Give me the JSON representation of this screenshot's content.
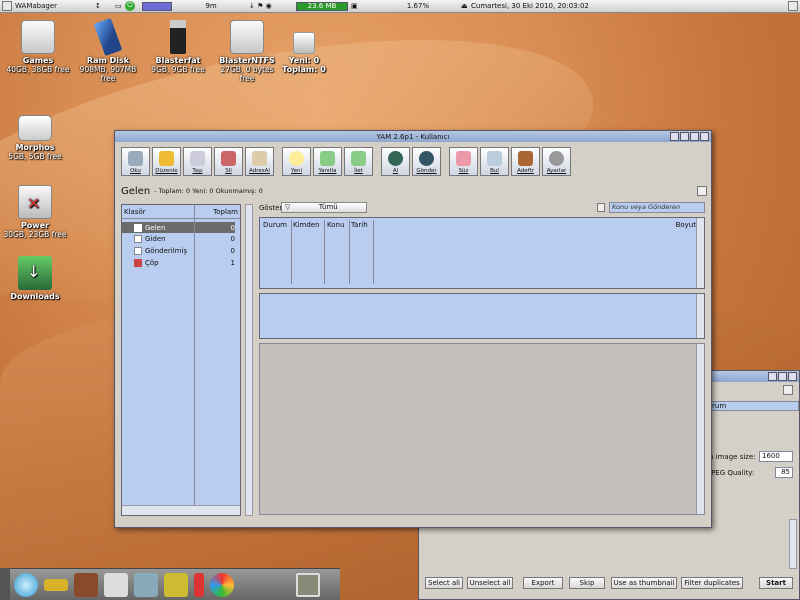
{
  "topbar": {
    "app": "WAMabager",
    "cpu_label": "9m",
    "mem": "23.6 MB",
    "load": "1.67%",
    "clock": "Cumartesi, 30 Eki 2010, 20:03:02"
  },
  "desktop": [
    {
      "name": "Games",
      "info": "40GB, 38GB free"
    },
    {
      "name": "Ram Disk",
      "info": "908MB, 907MB free"
    },
    {
      "name": "Blasterfat",
      "info": "9GB, 9GB free"
    },
    {
      "name": "BlasterNTFS",
      "info": "27GB, 0 bytes free"
    },
    {
      "name": "Yeni: 0",
      "info": "Toplam: 0"
    },
    {
      "name": "Morphos",
      "info": "5GB, 5GB free"
    },
    {
      "name": "Power",
      "info": "30GB, 23GB free"
    },
    {
      "name": "Downloads",
      "info": ""
    }
  ],
  "yam": {
    "title": "YAM 2.6p1 - Kullanıcı",
    "tools": [
      "Oku",
      "Düzenle",
      "Taşı",
      "Sil",
      "AdresAl",
      "Yeni",
      "Yanıtla",
      "İlet",
      "Al",
      "Gönder",
      "Süz",
      "Bul",
      "Adeftr",
      "Ayarlar"
    ],
    "folder_title": "Gelen",
    "folder_stats": "- Toplam: 0 Yeni: 0 Okunmamış: 0",
    "folders_col": {
      "name": "Klasör",
      "total": "Toplam"
    },
    "folders": [
      {
        "name": "Gelen",
        "count": "0"
      },
      {
        "name": "Giden",
        "count": "0"
      },
      {
        "name": "Gönderilmiş",
        "count": "0"
      },
      {
        "name": "Çöp",
        "count": "1"
      }
    ],
    "show_label": "Göster",
    "show_value": "Tümü",
    "search_placeholder": "Konu veya Gönderen",
    "cols": [
      "Durum",
      "Kimden",
      "Konu",
      "Tarih",
      "Boyut"
    ]
  },
  "gallery": {
    "field1": "rum",
    "image_size_label": "n image size:",
    "image_size": "1600",
    "jpeg_label": "JPEG Quality:",
    "jpeg": "85",
    "buttons": [
      "Select all",
      "Unselect all",
      "Export",
      "Skip",
      "Use as thumbnail",
      "Filter duplicates",
      "Start"
    ]
  }
}
